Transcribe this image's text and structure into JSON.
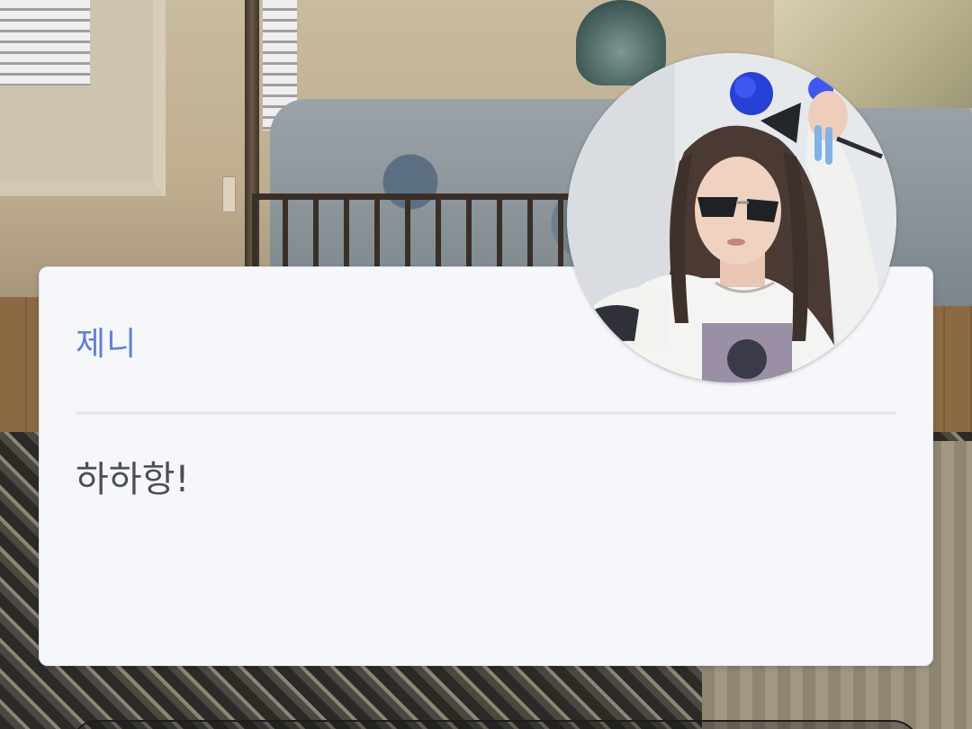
{
  "profile": {
    "name": "제니",
    "status_message": "하하항!",
    "avatar_icon": "profile-photo"
  },
  "colors": {
    "name_accent": "#5c7ee0",
    "message_text": "#4a4f57",
    "card_background": "#f5f7fa"
  }
}
